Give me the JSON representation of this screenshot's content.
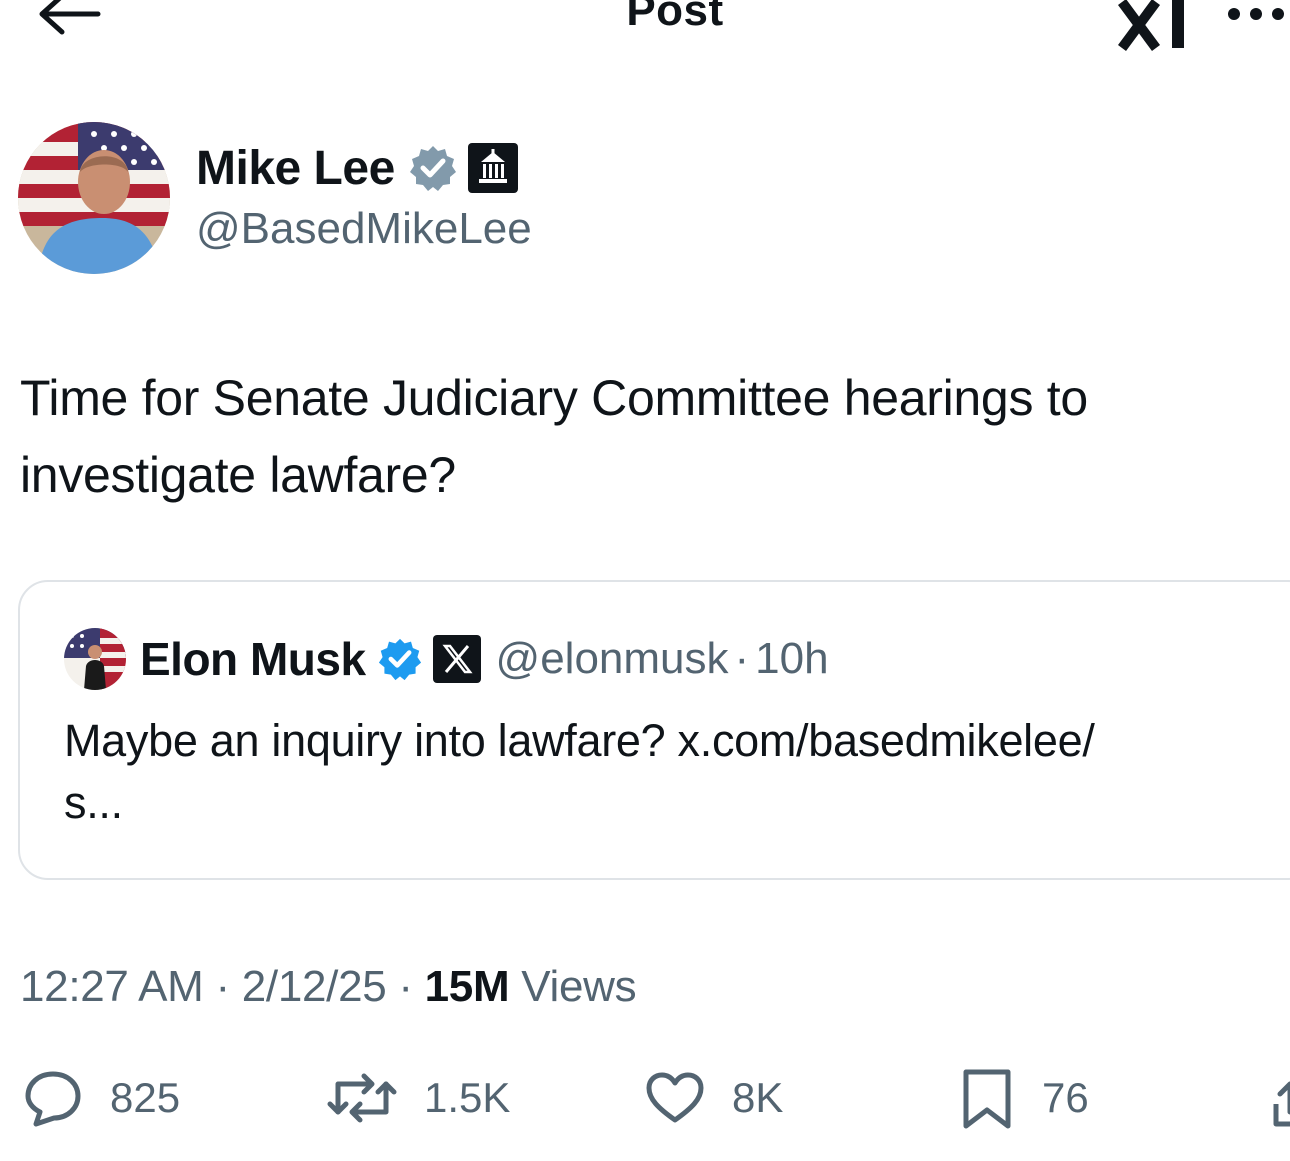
{
  "header": {
    "title": "Post",
    "back_icon": "arrow-left-icon",
    "grok_icon": "grok-icon",
    "more_icon": "more-dots-icon"
  },
  "author": {
    "name": "Mike Lee",
    "handle": "@BasedMikeLee",
    "verified_icon": "verified-badge-icon",
    "affiliation_icon": "government-building-icon"
  },
  "tweet": {
    "text": "Time for Senate Judiciary Committee hearings to investigate lawfare?"
  },
  "quote": {
    "name": "Elon Musk",
    "handle": "@elonmusk",
    "separator": "·",
    "time": "10h",
    "text_line1": "Maybe an inquiry into lawfare? x.com/basedmikelee/",
    "text_line2": "s..."
  },
  "meta": {
    "time": "12:27 AM",
    "sep1": " · ",
    "date": "2/12/25",
    "sep2": " · ",
    "views_count": "15M",
    "views_label": " Views"
  },
  "actions": {
    "replies": "825",
    "reposts": "1.5K",
    "likes": "8K",
    "bookmarks": "76"
  },
  "colors": {
    "text": "#0f1419",
    "secondary": "#536471",
    "verified_blue": "#1d9bf0",
    "verified_gray": "#829aab",
    "border": "#dfe3e7"
  }
}
